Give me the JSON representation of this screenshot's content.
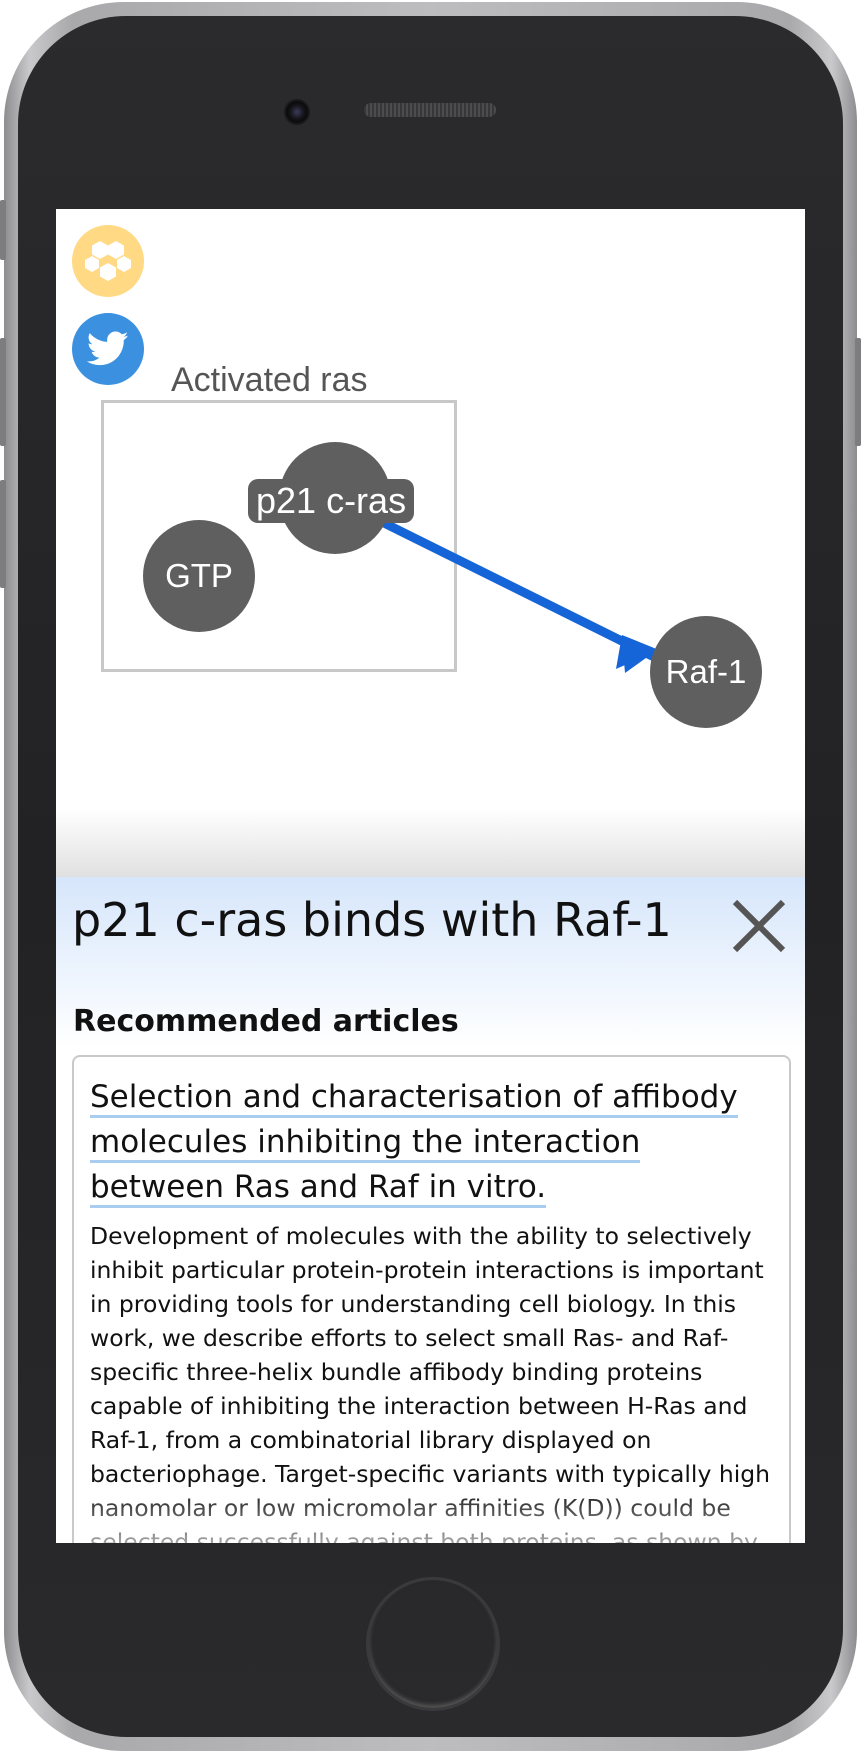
{
  "sidebar": {
    "hex_icon": "hexagons-icon",
    "twitter_icon": "twitter-icon"
  },
  "graph": {
    "compound_label": "Activated ras",
    "nodes": {
      "gtp": "GTP",
      "ras": "p21 c-ras",
      "raf": "Raf-1"
    },
    "edge_color": "#1565d8"
  },
  "panel": {
    "title": "p21 c-ras binds with Raf-1",
    "close_icon": "close-icon",
    "recommended_heading": "Recommended articles",
    "article": {
      "title": "Selection and characterisation of affibody molecules inhibiting the interaction between Ras and Raf in vitro.",
      "abstract": "Development of molecules with the ability to selectively inhibit particular protein-protein interactions is important in providing tools for understanding cell biology. In this work, we describe efforts to select small Ras- and Raf-specific three-helix bundle affibody binding proteins capable of inhibiting the interaction between H-Ras and Raf-1, from a combinatorial library displayed on bacteriophage. Target-specific variants with typically high nanomolar or low micromolar affinities (K(D)) could be selected successfully against both proteins, as shown by"
    }
  },
  "colors": {
    "accent_yellow": "#ffd983",
    "twitter_blue": "#3b91e0",
    "node_gray": "#5f5f5f",
    "panel_blue": "#d6e6fb"
  }
}
